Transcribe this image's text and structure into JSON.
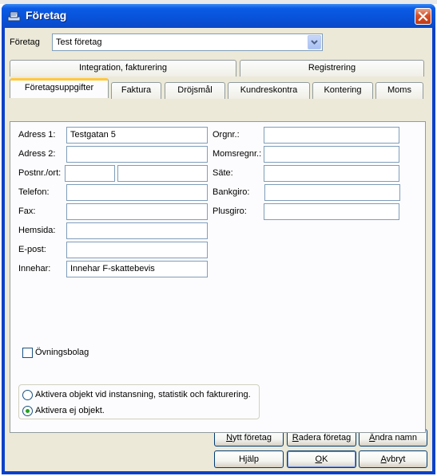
{
  "window": {
    "title": "Företag"
  },
  "company_selector": {
    "label": "Företag",
    "value": "Test företag"
  },
  "tabs_row1": [
    {
      "label": "Integration, fakturering"
    },
    {
      "label": "Registrering"
    }
  ],
  "tabs_row2": [
    {
      "label": "Företagsuppgifter",
      "active": true
    },
    {
      "label": "Faktura"
    },
    {
      "label": "Dröjsmål"
    },
    {
      "label": "Kundreskontra"
    },
    {
      "label": "Kontering"
    },
    {
      "label": "Moms"
    }
  ],
  "form_left": {
    "address1": {
      "label": "Adress 1:",
      "value": "Testgatan 5"
    },
    "address2": {
      "label": "Adress 2:",
      "value": ""
    },
    "postal": {
      "label": "Postnr./ort:",
      "postnr": "",
      "ort": ""
    },
    "phone": {
      "label": "Telefon:",
      "value": ""
    },
    "fax": {
      "label": "Fax:",
      "value": ""
    },
    "homepage": {
      "label": "Hemsida:",
      "value": ""
    },
    "email": {
      "label": "E-post:",
      "value": ""
    },
    "holder": {
      "label": "Innehar:",
      "value": "Innehar F-skattebevis"
    }
  },
  "form_right": {
    "orgnr": {
      "label": "Orgnr.:",
      "value": ""
    },
    "vatnr": {
      "label": "Momsregnr.:",
      "value": ""
    },
    "seat": {
      "label": "Säte:",
      "value": ""
    },
    "bankgiro": {
      "label": "Bankgiro:",
      "value": ""
    },
    "plusgiro": {
      "label": "Plusgiro:",
      "value": ""
    }
  },
  "practice_company": {
    "label": "Övningsbolag",
    "checked": false
  },
  "activation": {
    "option1": {
      "label": "Aktivera objekt vid instansning, statistik och fakturering.",
      "selected": false
    },
    "option2": {
      "label": "Aktivera ej objekt.",
      "selected": true
    }
  },
  "buttons": {
    "new_company": {
      "label_pre": "",
      "label_ul": "N",
      "label_post": "ytt företag"
    },
    "delete_company": {
      "label_pre": "",
      "label_ul": "R",
      "label_post": "adera företag"
    },
    "rename": {
      "label_pre": "",
      "label_ul": "Ä",
      "label_post": "ndra namn"
    },
    "help": {
      "label": "Hjälp"
    },
    "ok": {
      "label_pre": "",
      "label_ul": "O",
      "label_post": "K"
    },
    "cancel": {
      "label_pre": "",
      "label_ul": "A",
      "label_post": "vbryt"
    }
  },
  "colors": {
    "titlebar": "#0852d8",
    "client_bg": "#ece9d8",
    "active_tab_accent": "#ffc83c",
    "close_button": "#d5502a"
  },
  "icons": {
    "title": "app-icon",
    "close": "close-icon",
    "dropdown": "chevron-down-icon"
  }
}
